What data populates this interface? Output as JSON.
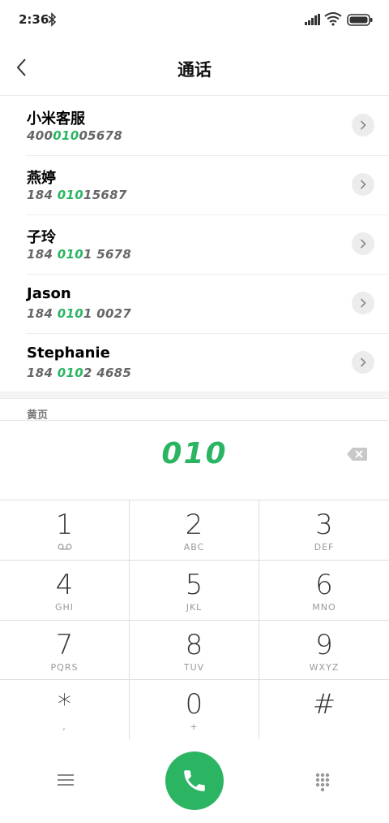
{
  "status": {
    "time": "2:36"
  },
  "header": {
    "title": "通话"
  },
  "contacts": [
    {
      "name": "小米客服",
      "number_pre": "400",
      "number_hl": "010",
      "number_post": "05678"
    },
    {
      "name": "燕婷",
      "number_pre": "184 ",
      "number_hl": "010",
      "number_post": "15687"
    },
    {
      "name": "子玲",
      "number_pre": "184 ",
      "number_hl": "010",
      "number_post": "1 5678"
    },
    {
      "name": "Jason",
      "number_pre": "184 ",
      "number_hl": "010",
      "number_post": "1 0027"
    },
    {
      "name": "Stephanie",
      "number_pre": "184 ",
      "number_hl": "010",
      "number_post": "2 4685"
    }
  ],
  "section": {
    "label": "黄页"
  },
  "dial": {
    "number": "010"
  },
  "keypad": [
    {
      "digit": "1",
      "letters": ""
    },
    {
      "digit": "2",
      "letters": "ABC"
    },
    {
      "digit": "3",
      "letters": "DEF"
    },
    {
      "digit": "4",
      "letters": "GHI"
    },
    {
      "digit": "5",
      "letters": "JKL"
    },
    {
      "digit": "6",
      "letters": "MNO"
    },
    {
      "digit": "7",
      "letters": "PQRS"
    },
    {
      "digit": "8",
      "letters": "TUV"
    },
    {
      "digit": "9",
      "letters": "WXYZ"
    },
    {
      "digit": "*",
      "letters": ","
    },
    {
      "digit": "0",
      "letters": "+"
    },
    {
      "digit": "#",
      "letters": ""
    }
  ],
  "colors": {
    "accent": "#2bb563",
    "divider": "#dddddd"
  }
}
